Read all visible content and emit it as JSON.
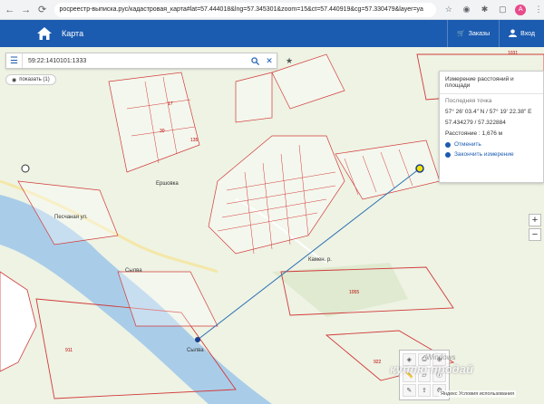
{
  "browser": {
    "url": "росреестр-выписка.рус/кадастровая_карта#lat=57.444018&lng=57.345301&zoom=15&ct=57.440919&cg=57.330479&layer=ya",
    "avatar_letter": "A"
  },
  "appbar": {
    "title": "Карта",
    "orders_label": "Заказы",
    "login_label": "Вход"
  },
  "search": {
    "value": "59:22:1410101:1333"
  },
  "show_button": "показать (1)",
  "measure_panel": {
    "header": "Измерение расстояний и площади",
    "last_point_label": "Последняя точка",
    "coords_dms": "57° 26' 03.4\" N / 57° 19' 22.38\" E",
    "coords_decimal": "57.434279 / 57.322884",
    "distance_label": "Расстояние :",
    "distance_value": "1,676 м",
    "cancel": "Отменить",
    "finish": "Закончить измерение"
  },
  "map_labels": {
    "village": "Ершовка",
    "river1": "Сылва",
    "river2": "Сылва",
    "road": "Песчаная ул.",
    "kamen": "Камен. р.",
    "parcel_1055": "1055",
    "parcel_911": "911",
    "parcel_922": "922",
    "parcel_1031": "1031",
    "parcel_17": "17",
    "parcel_30": "30",
    "parcel_135": "135"
  },
  "attribution": "Яндекс Условия использования",
  "watermark": "куплю продай",
  "windows_text": "Windows",
  "colors": {
    "appbar": "#1b5bb0",
    "parcel": "#d23b3b",
    "river": "#a9cde8",
    "measure_line": "#2a6fb3"
  },
  "icons": {
    "home": "home-icon",
    "cart": "cart-icon",
    "user": "user-icon",
    "menu": "menu-icon",
    "search": "search-icon",
    "close": "close-icon",
    "star": "star-icon"
  }
}
